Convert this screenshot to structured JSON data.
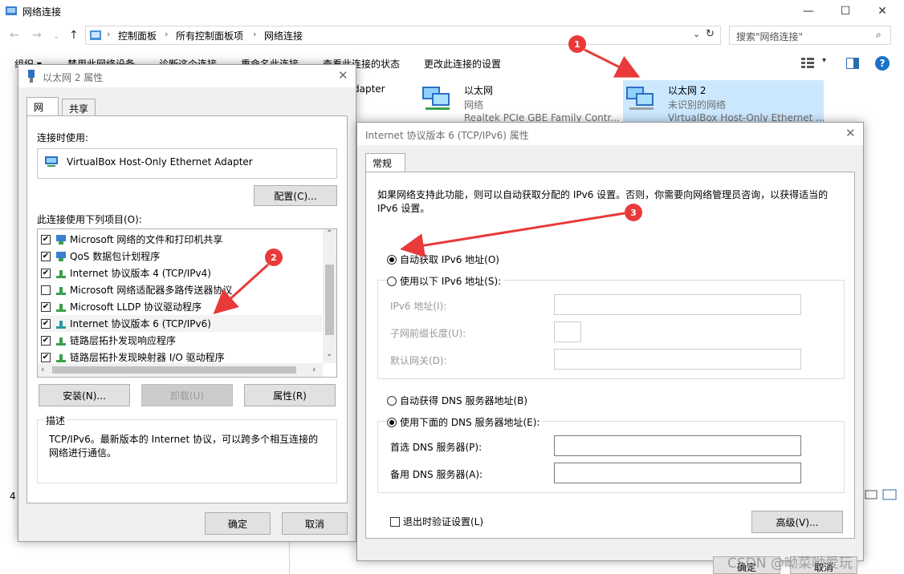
{
  "window": {
    "title": "网络连接",
    "minimize_glyph": "—",
    "maximize_glyph": "☐",
    "close_glyph": "✕"
  },
  "address": {
    "crumbs": [
      "控制面板",
      "所有控制面板项",
      "网络连接"
    ],
    "search_placeholder": "搜索\"网络连接\""
  },
  "toolbar": {
    "items": [
      "组织 ▾",
      "禁用此网络设备",
      "诊断这个连接",
      "重命名此连接",
      "查看此连接的状态",
      "更改此连接的设置"
    ]
  },
  "adapters": [
    {
      "name": "dapter",
      "sub": "",
      "sub2": ""
    },
    {
      "name": "以太网",
      "sub": "网络",
      "sub2": "Realtek PCIe GBE Family Contr..."
    },
    {
      "name": "以太网 2",
      "sub": "未识别的网络",
      "sub2": "VirtualBox Host-Only Ethernet ..."
    }
  ],
  "status_count": "4",
  "props_dialog": {
    "title": "以太网 2 属性",
    "tabs": [
      "网络",
      "共享"
    ],
    "connect_using_label": "连接时使用:",
    "adapter_name": "VirtualBox Host-Only Ethernet Adapter",
    "configure_btn": "配置(C)...",
    "items_label": "此连接使用下列项目(O):",
    "items": [
      {
        "label": "Microsoft 网络的文件和打印机共享",
        "checked": true
      },
      {
        "label": "QoS 数据包计划程序",
        "checked": true
      },
      {
        "label": "Internet 协议版本 4 (TCP/IPv4)",
        "checked": true
      },
      {
        "label": "Microsoft 网络适配器多路传送器协议",
        "checked": false
      },
      {
        "label": "Microsoft LLDP 协议驱动程序",
        "checked": true
      },
      {
        "label": "Internet 协议版本 6 (TCP/IPv6)",
        "checked": true
      },
      {
        "label": "链路层拓扑发现响应程序",
        "checked": true
      },
      {
        "label": "链路层拓扑发现映射器 I/O 驱动程序",
        "checked": true
      }
    ],
    "install_btn": "安装(N)...",
    "uninstall_btn": "卸载(U)",
    "properties_btn": "属性(R)",
    "desc_label": "描述",
    "desc_text": "TCP/IPv6。最新版本的 Internet 协议，可以跨多个相互连接的网络进行通信。",
    "ok_btn": "确定",
    "cancel_btn": "取消"
  },
  "ipv6_dialog": {
    "title": "Internet 协议版本 6 (TCP/IPv6) 属性",
    "tab": "常规",
    "intro": "如果网络支持此功能，则可以自动获取分配的 IPv6 设置。否则，你需要向网络管理员咨询，以获得适当的 IPv6 设置。",
    "auto_ip": "自动获取 IPv6 地址(O)",
    "manual_ip": "使用以下 IPv6 地址(S):",
    "ipv6_addr_label": "IPv6 地址(I):",
    "prefix_label": "子网前缀长度(U):",
    "gateway_label": "默认网关(D):",
    "auto_dns": "自动获得 DNS 服务器地址(B)",
    "manual_dns": "使用下面的 DNS 服务器地址(E):",
    "pref_dns_label": "首选 DNS 服务器(P):",
    "alt_dns_label": "备用 DNS 服务器(A):",
    "validate_label": "退出时验证设置(L)",
    "advanced_btn": "高级(V)...",
    "ok_btn": "确定",
    "cancel_btn": "取消",
    "selected_ip_mode": "auto",
    "selected_dns_mode": "manual"
  },
  "annotations": [
    "1",
    "2",
    "3"
  ],
  "watermark": "CSDN @呦菜呦爱玩",
  "colors": {
    "arrow": "#e83a3a",
    "selection": "#cce8ff"
  }
}
